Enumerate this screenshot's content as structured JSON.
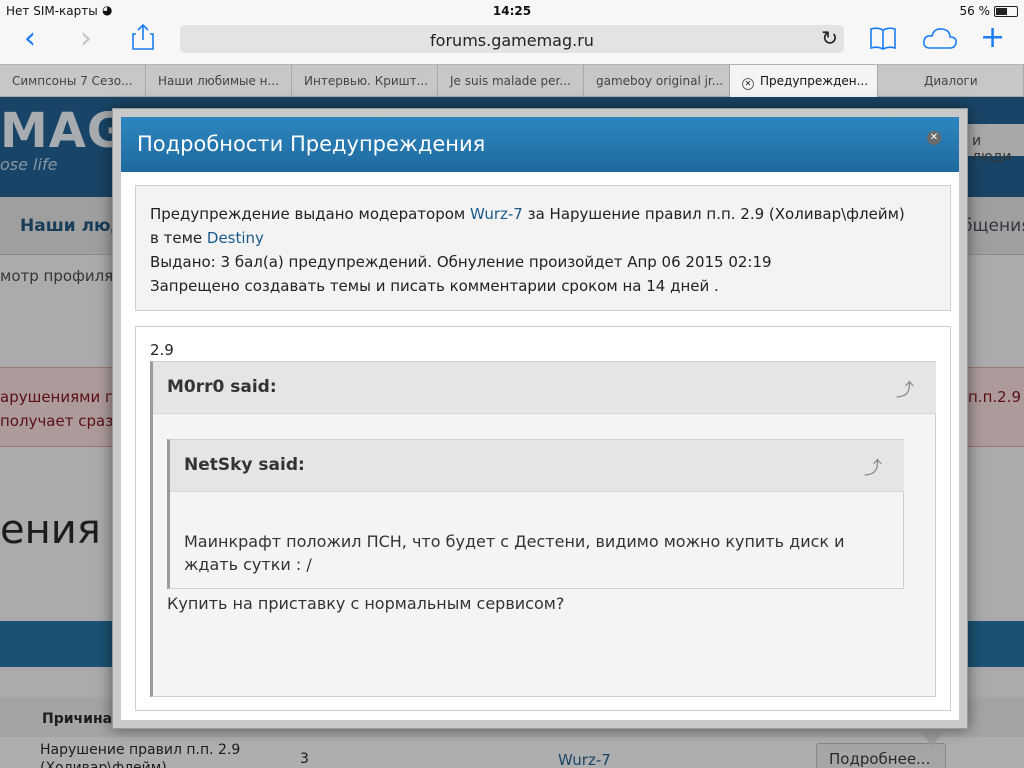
{
  "statusbar": {
    "carrier": "Нет SIM-карты",
    "time": "14:25",
    "battery_text": "56 %",
    "battery_level": 0.56
  },
  "toolbar": {
    "url": "forums.gamemag.ru",
    "icons": {
      "back": "chevron-left-icon",
      "forward": "chevron-right-icon",
      "share": "share-icon",
      "reload": "reload-icon",
      "bookmarks": "book-icon",
      "cloud_tabs": "cloud-icon",
      "new_tab": "plus-icon"
    },
    "accent": "#1a7cf5"
  },
  "tabs": [
    {
      "label": "Симпсоны 7 Сезо...",
      "active": false
    },
    {
      "label": "Наши любимые н...",
      "active": false
    },
    {
      "label": "Интервью. Кришт...",
      "active": false
    },
    {
      "label": "Je suis malade per...",
      "active": false
    },
    {
      "label": "gameboy original jr...",
      "active": false
    },
    {
      "label": "Предупрежден...",
      "active": true
    },
    {
      "label": "Диалоги",
      "active": false
    }
  ],
  "background": {
    "logo": "MAG",
    "logo_sub": "ose life",
    "people_field": "и люди",
    "nav_left": "Наши люд",
    "nav_right": "бщения",
    "crumb": "мотр профиля",
    "alert_line1": "арушениями пр",
    "alert_line2": "получает сразу",
    "alert_right": "п.п.2.9",
    "big_title": "ения М",
    "table_head": "Причина",
    "row": {
      "reason": "Нарушение правил п.п. 2.9 (Холивар\\флейм)",
      "points": "3",
      "moderator": "Wurz-7",
      "more_button": "Подробнее..."
    }
  },
  "modal": {
    "title": "Подробности Предупреждения",
    "close_icon": "close-icon",
    "info": {
      "issued_prefix": "Предупреждение выдано модератором",
      "moderator": "Wurz-7",
      "issued_reason": "за Нарушение правил п.п. 2.9 (Холивар\\флейм)",
      "topic_prefix": "в теме",
      "topic": "Destiny",
      "points_line": "Выдано: 3 бал(а) предупреждений. Обнуление произойдет Апр 06 2015 02:19",
      "ban_line": "Запрещено создавать темы и писать комментарии сроком на 14 дней ."
    },
    "message": {
      "value": "2.9",
      "quote_outer": {
        "author": "M0rr0 said:",
        "icon": "quote-arrow-icon",
        "text": "Купить на приставку с нормальным сервисом?"
      },
      "quote_inner": {
        "author": "NetSky said:",
        "icon": "quote-arrow-icon",
        "text": "Маинкрафт положил ПСН, что будет с Дестени, видимо можно купить диск и ждать сутки : /"
      }
    }
  }
}
